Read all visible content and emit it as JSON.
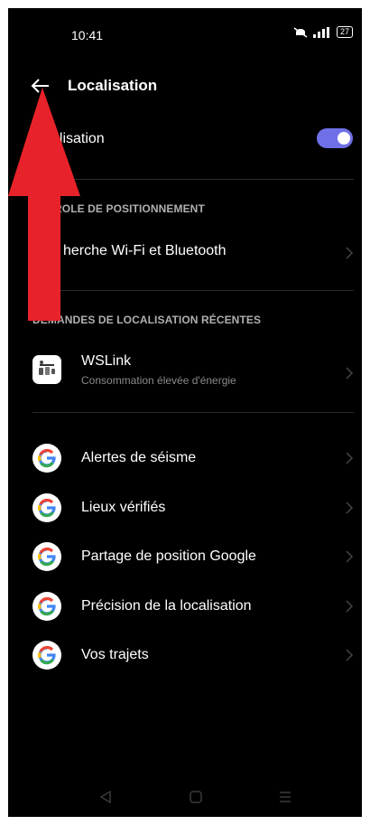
{
  "status": {
    "time": "10:41",
    "battery": "27"
  },
  "header": {
    "title": "Localisation"
  },
  "toggle_row": {
    "label": "alisation",
    "state": "on"
  },
  "section1": {
    "title": "ROLE DE POSITIONNEMENT"
  },
  "wifi_row": {
    "label": "herche Wi-Fi et Bluetooth"
  },
  "section2": {
    "title": "DEMANDES DE LOCALISATION RÉCENTES"
  },
  "recent": {
    "app": "WSLink",
    "detail": "Consommation élevée d'énergie"
  },
  "google_items": [
    "Alertes de séisme",
    "Lieux vérifiés",
    "Partage de position Google",
    "Précision de la localisation",
    "Vos trajets"
  ],
  "colors": {
    "accent": "#6f70e8",
    "overlay_arrow": "#e8222a"
  },
  "icons": {
    "back": "back-arrow-icon",
    "chevron": "chevron-right-icon",
    "google": "google-g-icon",
    "app": "wslink-weather-station-icon"
  }
}
